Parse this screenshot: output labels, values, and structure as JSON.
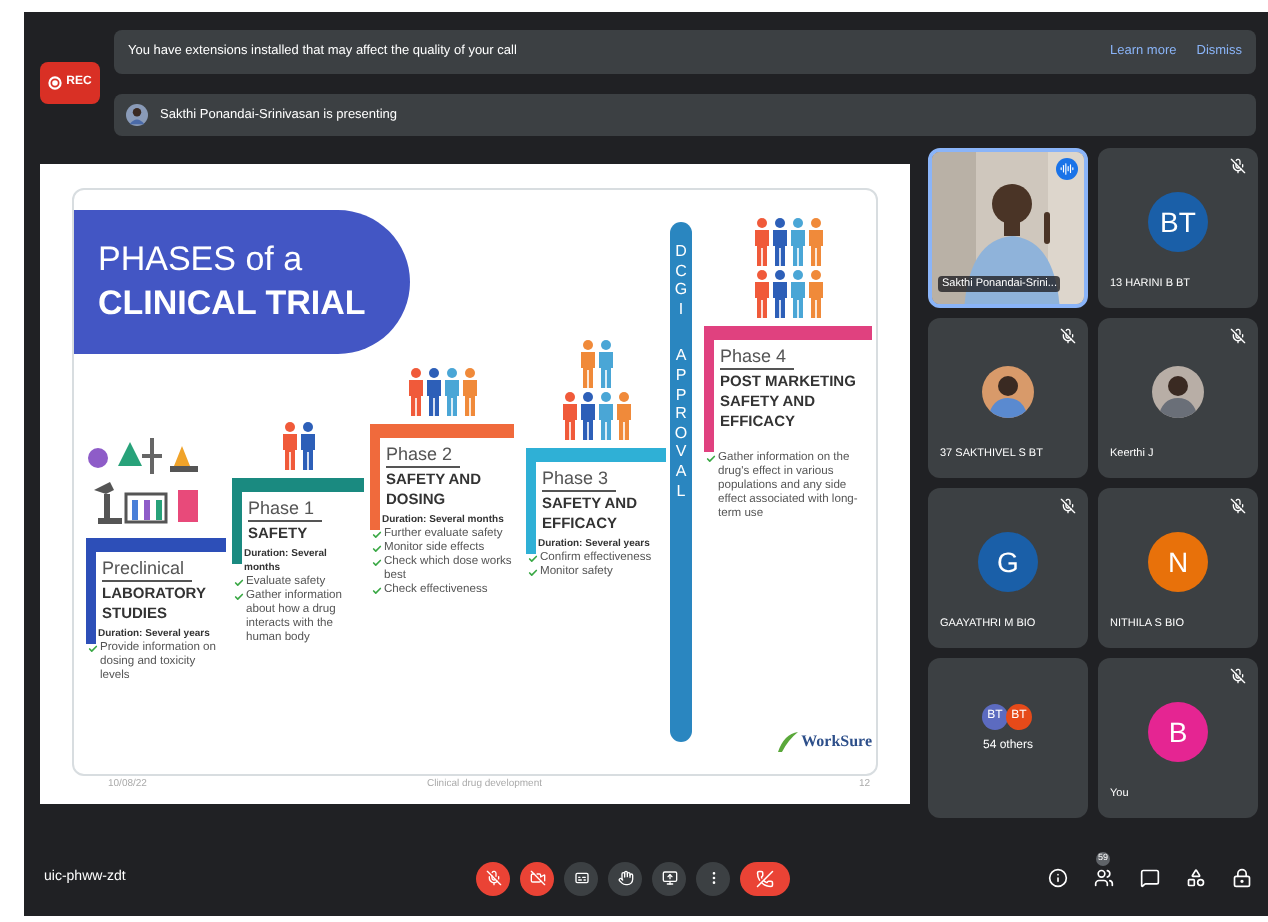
{
  "recording": {
    "label": "REC"
  },
  "notice": {
    "text": "You have extensions installed that may affect the quality of your call",
    "links": [
      "Learn more",
      "Dismiss"
    ]
  },
  "presenting": {
    "text": "Sakthi Ponandai-Srinivasan is presenting"
  },
  "slide": {
    "title_lines": [
      "PHASES of a",
      "CLINICAL TRIAL"
    ],
    "phases": [
      {
        "label": "Preclinical",
        "title": "LABORATORY STUDIES",
        "duration": "Duration: Several years",
        "points": [
          "Provide information on dosing and toxicity levels"
        ],
        "color": "#2d4fb8"
      },
      {
        "label": "Phase 1",
        "title": "SAFETY",
        "duration": "Duration: Several months",
        "points": [
          "Evaluate safety",
          "Gather information about how a drug interacts with the human body"
        ],
        "color": "#1a8a80"
      },
      {
        "label": "Phase 2",
        "title": "SAFETY AND DOSING",
        "duration": "Duration: Several months",
        "points": [
          "Further evaluate safety",
          "Monitor side effects",
          "Check which dose works best",
          "Check effectiveness"
        ],
        "color": "#f06a3c"
      },
      {
        "label": "Phase 3",
        "title": "SAFETY AND EFFICACY",
        "duration": "Duration: Several years",
        "points": [
          "Confirm effectiveness",
          "Monitor safety"
        ],
        "color": "#2fb0d6"
      },
      {
        "label": "Phase 4",
        "title": "POST MARKETING SAFETY AND EFFICACY",
        "points": [
          "Gather information on the drug's effect in various populations and any side effect associated with long-term use"
        ],
        "color": "#e0417f"
      }
    ],
    "approval": [
      "DCGI",
      "APPROVAL"
    ],
    "logo": "WorkSure",
    "footer_date": "10/08/22",
    "footer_text": "Clinical drug development",
    "page": "12"
  },
  "tiles": [
    {
      "kind": "video",
      "name": "Sakthi Ponandai-Srini...",
      "speaking": true,
      "muted": false
    },
    {
      "kind": "avatar",
      "name": "13 HARINI B BT",
      "initials": "BT",
      "color": "#1a5fa8",
      "muted": true
    },
    {
      "name": "37 SAKTHIVEL S BT",
      "muted": true
    },
    {
      "name": "Keerthi J",
      "muted": true
    },
    {
      "kind": "avatar",
      "name": "GAAYATHRI M BIO",
      "initials": "G",
      "color": "#1a5fa8",
      "muted": true
    },
    {
      "kind": "avatar",
      "name": "NITHILA S BIO",
      "initials": "N",
      "color": "#e8710a",
      "muted": true
    },
    {
      "kind": "others",
      "name": "54 others",
      "avatars": [
        {
          "initials": "BT",
          "color": "#5c6bc0"
        },
        {
          "initials": "BT",
          "color": "#e64a19"
        }
      ],
      "muted": false
    },
    {
      "kind": "avatar",
      "name": "You",
      "initials": "B",
      "color": "#e52592",
      "muted": true
    }
  ],
  "meeting_code": "uic-phww-zdt",
  "controls": [
    {
      "kind": "mic",
      "on": false
    },
    {
      "kind": "camera",
      "on": false
    },
    {
      "kind": "captions"
    },
    {
      "kind": "hand"
    },
    {
      "kind": "present"
    },
    {
      "kind": "more"
    },
    {
      "kind": "leave"
    }
  ],
  "side_controls": [
    {
      "kind": "info"
    },
    {
      "kind": "people",
      "badge": "59"
    },
    {
      "kind": "chat"
    },
    {
      "kind": "activities"
    },
    {
      "kind": "lock"
    }
  ]
}
